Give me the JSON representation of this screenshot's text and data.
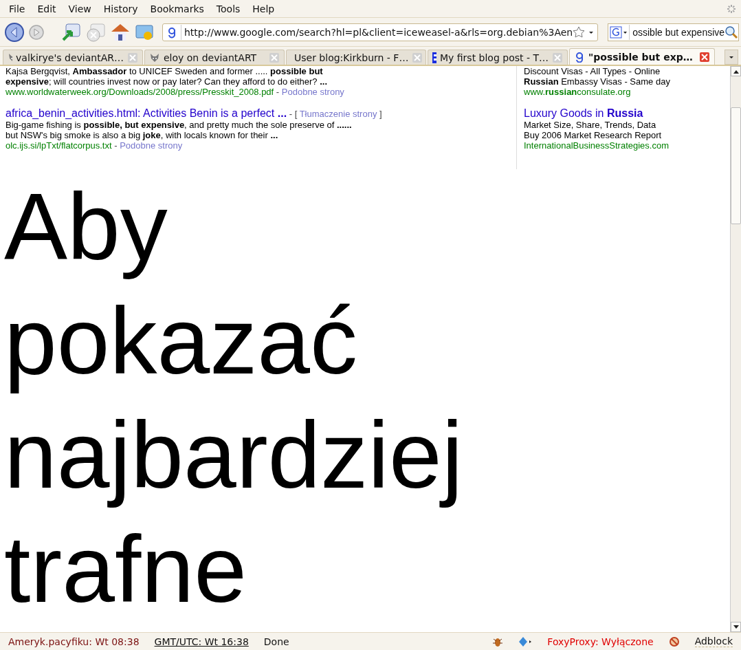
{
  "menu_bar": {
    "items": [
      {
        "label": "File"
      },
      {
        "label": "Edit"
      },
      {
        "label": "View"
      },
      {
        "label": "History"
      },
      {
        "label": "Bookmarks"
      },
      {
        "label": "Tools"
      },
      {
        "label": "Help"
      }
    ]
  },
  "navigation": {
    "back": {
      "disabled": false
    },
    "forward": {
      "disabled": true
    },
    "stop": {
      "disabled": true
    },
    "url": "http://www.google.com/search?hl=pl&client=iceweasel-a&rls=org.debian%3Aen",
    "search": "ossible but expensive"
  },
  "tabs": [
    {
      "label": "valkirye's deviantAR…",
      "selected": false,
      "kind": "devil"
    },
    {
      "label": "eloy on deviantART",
      "selected": false,
      "kind": "devil"
    },
    {
      "label": "User blog:Kirkburn - F…",
      "selected": false,
      "kind": "wiki"
    },
    {
      "label": "My first blog post - T…",
      "selected": false,
      "kind": "blog"
    },
    {
      "label": "\"possible but exp…",
      "selected": true,
      "kind": "search"
    }
  ],
  "results": [
    {
      "snippet": [
        "Kajsa Bergqvist, **Ambassador** to UNICEF Sweden and former ..... **possible but**",
        "**expensive**; will countries invest now or pay later? Can they afford to do either? **...**"
      ],
      "url": "www.worldwaterweek.org/Downloads/2008/press/Presskit_2008.pdf",
      "separator": "-",
      "similar": "Podobne strony"
    },
    {
      "title": "africa_benin_activities.html: Activities Benin is a perfect **...**",
      "bracket_open": "- [",
      "translate": "Tłumaczenie strony",
      "bracket_close": "]",
      "snippet": [
        "Big-game fishing is **possible, but expensive**, and pretty much the sole preserve of **......**",
        "but NSW's big smoke is also a big **joke**, with locals known for their **...**"
      ],
      "url": "olc.ijs.si/lpTxt/flatcorpus.txt",
      "separator": "-",
      "similar": "Podobne strony"
    }
  ],
  "ads": [
    {
      "lines": [
        "Discount Visas - All Types - Online",
        "**Russian** Embassy Visas - Same day"
      ],
      "url": "www.**russian**consulate.org"
    },
    {
      "title": "Luxury Goods in **Russia**",
      "lines": [
        "Market Size, Share, Trends, Data",
        "Buy 2006 Market Research Report"
      ],
      "url": "InternationalBusinessStrategies.com"
    }
  ],
  "big_text": [
    "Aby",
    "pokazać",
    "najbardziej",
    "trafne"
  ],
  "status_bar": {
    "pacific_time": "Ameryk.pacyfiku: Wt 08:38",
    "utc_time": "GMT/UTC: Wt 16:38",
    "status": "Done",
    "foxyproxy": "FoxyProxy: Wyłączone",
    "adblock": "Adblock"
  }
}
